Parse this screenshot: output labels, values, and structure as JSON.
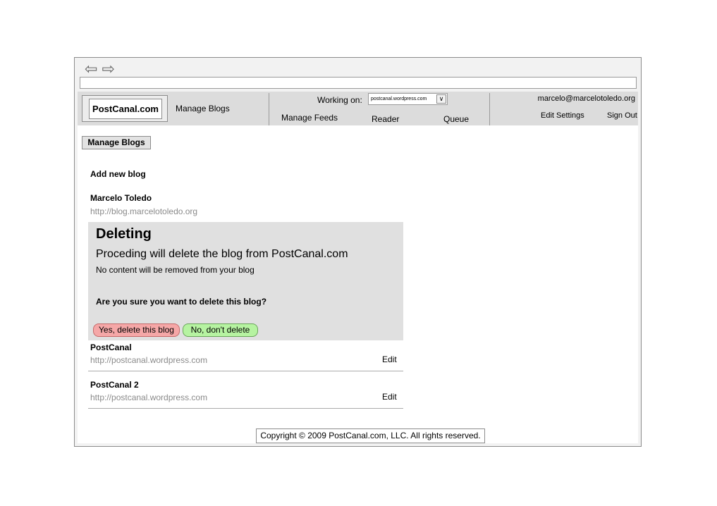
{
  "browser": {
    "back_glyph": "⇦",
    "forward_glyph": "⇨",
    "address": ""
  },
  "header": {
    "logo": "PostCanal.com",
    "manage_blogs": "Manage Blogs",
    "working_on_label": "Working on:",
    "selected_blog": "postcanal.wordpress.com",
    "manage_feeds": "Manage Feeds",
    "reader": "Reader",
    "queue": "Queue",
    "user_email": "marcelo@marcelotoledo.org",
    "edit_settings": "Edit Settings",
    "sign_out": "Sign Out"
  },
  "page": {
    "section_title": "Manage Blogs",
    "add_new_blog": "Add new blog"
  },
  "blogs": [
    {
      "name": "Marcelo Toledo",
      "url": "http://blog.marcelotoledo.org"
    },
    {
      "name": "PostCanal",
      "url": "http://postcanal.wordpress.com",
      "edit_label": "Edit"
    },
    {
      "name": "PostCanal 2",
      "url": "http://postcanal.wordpress.com",
      "edit_label": "Edit"
    }
  ],
  "delete_dialog": {
    "title": "Deleting",
    "subtitle": "Proceding will delete the blog from PostCanal.com",
    "note": "No content will be removed from your blog",
    "question": "Are you sure you want to delete this blog?",
    "confirm_label": "Yes, delete this blog",
    "cancel_label": "No, don't delete"
  },
  "footer": {
    "copyright": "Copyright © 2009 PostCanal.com, LLC. All rights reserved."
  },
  "colors": {
    "confirm_button": "#f5a7a7",
    "cancel_button": "#b6f3a1",
    "header_bg": "#dcdcdc",
    "panel_bg": "#e0e0e0"
  }
}
